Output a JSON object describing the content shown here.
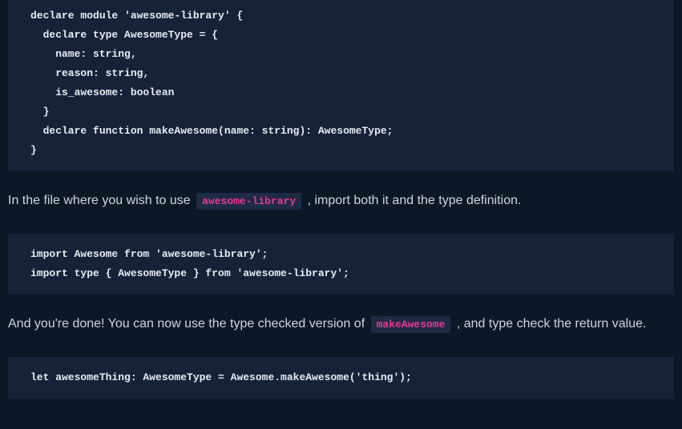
{
  "code_blocks": {
    "declare": "declare module 'awesome-library' {\n  declare type AwesomeType = {\n    name: string,\n    reason: string,\n    is_awesome: boolean\n  }\n  declare function makeAwesome(name: string): AwesomeType;\n}",
    "import": "import Awesome from 'awesome-library';\nimport type { AwesomeType } from 'awesome-library';",
    "usage": "let awesomeThing: AwesomeType = Awesome.makeAwesome('thing');"
  },
  "prose": {
    "p1_before": "In the file where you wish to use ",
    "p1_code": "awesome-library",
    "p1_after": " , import both it and the type definition.",
    "p2_before": "And you're done! You can now use the type checked version of ",
    "p2_code": "makeAwesome",
    "p2_after": " , and type check the return value."
  }
}
